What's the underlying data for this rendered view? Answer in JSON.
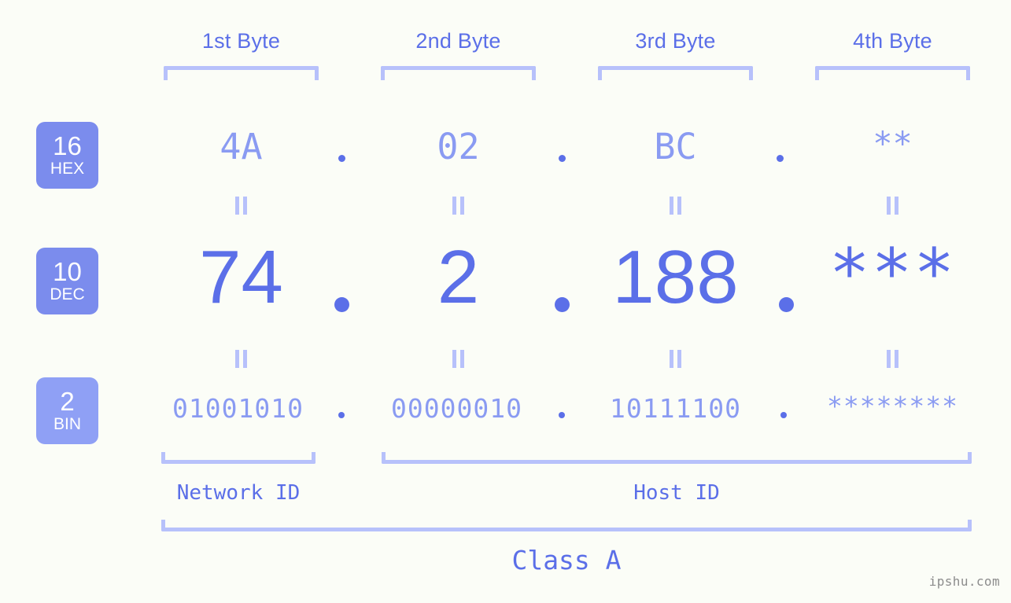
{
  "background_color": "#fbfdf7",
  "accent_color": "#5b6fe8",
  "accent_light_color": "#8a9bf2",
  "bracket_color": "#b7c1fb",
  "headers": {
    "byte1": "1st Byte",
    "byte2": "2nd Byte",
    "byte3": "3rd Byte",
    "byte4": "4th Byte"
  },
  "bases": [
    {
      "number": "16",
      "label": "HEX"
    },
    {
      "number": "10",
      "label": "DEC"
    },
    {
      "number": "2",
      "label": "BIN"
    }
  ],
  "rows": {
    "hex": {
      "base_number": "16",
      "base_label": "HEX",
      "bytes": [
        "4A",
        "02",
        "BC",
        "**"
      ],
      "separator": "."
    },
    "dec": {
      "base_number": "10",
      "base_label": "DEC",
      "bytes": [
        "74",
        "2",
        "188",
        "***"
      ],
      "separator": "."
    },
    "bin": {
      "base_number": "2",
      "base_label": "BIN",
      "bytes": [
        "01001010",
        "00000010",
        "10111100",
        "********"
      ],
      "separator": "."
    }
  },
  "equality_mark": "=",
  "sections": {
    "network_id": "Network ID",
    "host_id": "Host ID",
    "class": "Class A"
  },
  "watermark": "ipshu.com"
}
